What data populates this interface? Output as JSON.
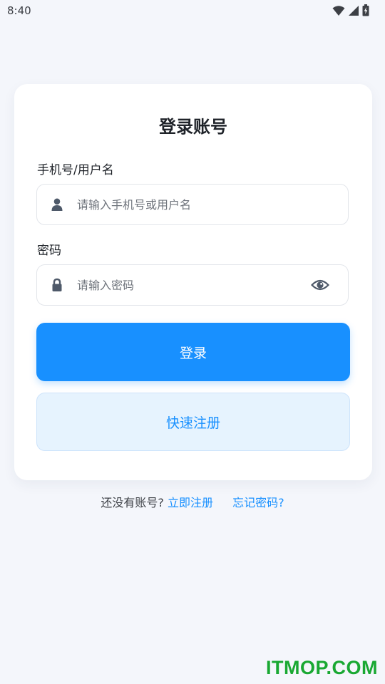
{
  "status_bar": {
    "time": "8:40",
    "icons": [
      "wifi-icon",
      "cellular-signal-icon",
      "battery-charging-icon"
    ]
  },
  "login_card": {
    "title": "登录账号",
    "account": {
      "label": "手机号/用户名",
      "placeholder": "请输入手机号或用户名",
      "value": "",
      "icon": "user-icon"
    },
    "password": {
      "label": "密码",
      "placeholder": "请输入密码",
      "value": "",
      "icon": "lock-icon",
      "toggle_icon": "eye-icon"
    },
    "login_button": "登录",
    "register_button": "快速注册"
  },
  "footer": {
    "prompt": "还没有账号?",
    "register_link": "立即注册",
    "forgot_link": "忘记密码?"
  },
  "watermark": "ITMOP.COM",
  "colors": {
    "primary": "#1890FF",
    "secondary_button_bg": "#E6F3FE",
    "page_background": "#F4F6FB",
    "card_background": "#FFFFFF",
    "watermark": "#19A832"
  }
}
